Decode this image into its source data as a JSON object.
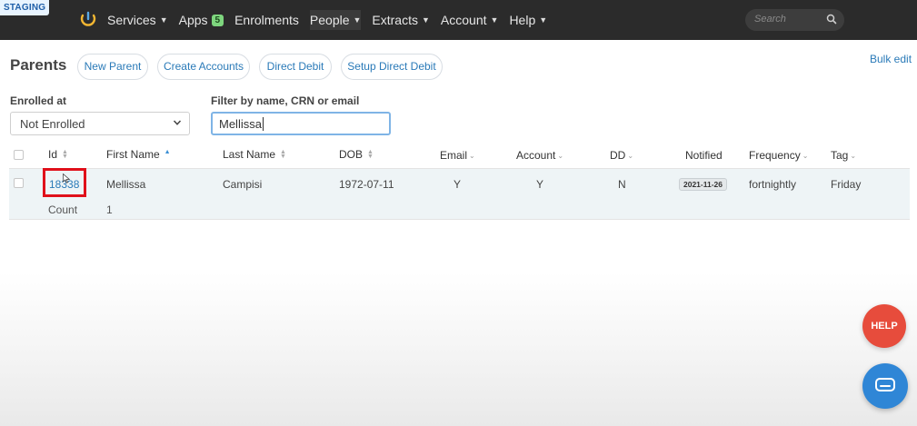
{
  "env_badge": "STAGING",
  "nav": {
    "items": [
      {
        "label": "Services",
        "caret": true
      },
      {
        "label": "Apps",
        "badge": "5"
      },
      {
        "label": "Enrolments"
      },
      {
        "label": "People",
        "caret": true
      },
      {
        "label": "Extracts",
        "caret": true
      },
      {
        "label": "Account",
        "caret": true
      },
      {
        "label": "Help",
        "caret": true
      }
    ],
    "search_placeholder": "Search"
  },
  "page": {
    "title": "Parents",
    "actions": [
      "New Parent",
      "Create Accounts",
      "Direct Debit",
      "Setup Direct Debit"
    ],
    "bulk_edit": "Bulk edit"
  },
  "filters": {
    "enrolled_label": "Enrolled at",
    "enrolled_value": "Not Enrolled",
    "search_label": "Filter by name, CRN or email",
    "search_value": "Mellissa"
  },
  "table": {
    "columns": [
      "Id",
      "First Name",
      "Last Name",
      "DOB",
      "Email",
      "Account",
      "DD",
      "Notified",
      "Frequency",
      "Tag"
    ],
    "rows": [
      {
        "id": "18338",
        "first_name": "Mellissa",
        "last_name": "Campisi",
        "dob": "1972-07-11",
        "email": "Y",
        "account": "Y",
        "dd": "N",
        "notified": "2021-11-26",
        "frequency": "fortnightly",
        "tag": "Friday"
      }
    ],
    "count_label": "Count",
    "count_value": "1"
  },
  "help_button": "HELP",
  "colors": {
    "accent": "#2a7ab8",
    "topbar": "#2b2b2b",
    "highlight": "#e0101a",
    "help": "#e74c3c",
    "chat": "#2f86d6"
  }
}
